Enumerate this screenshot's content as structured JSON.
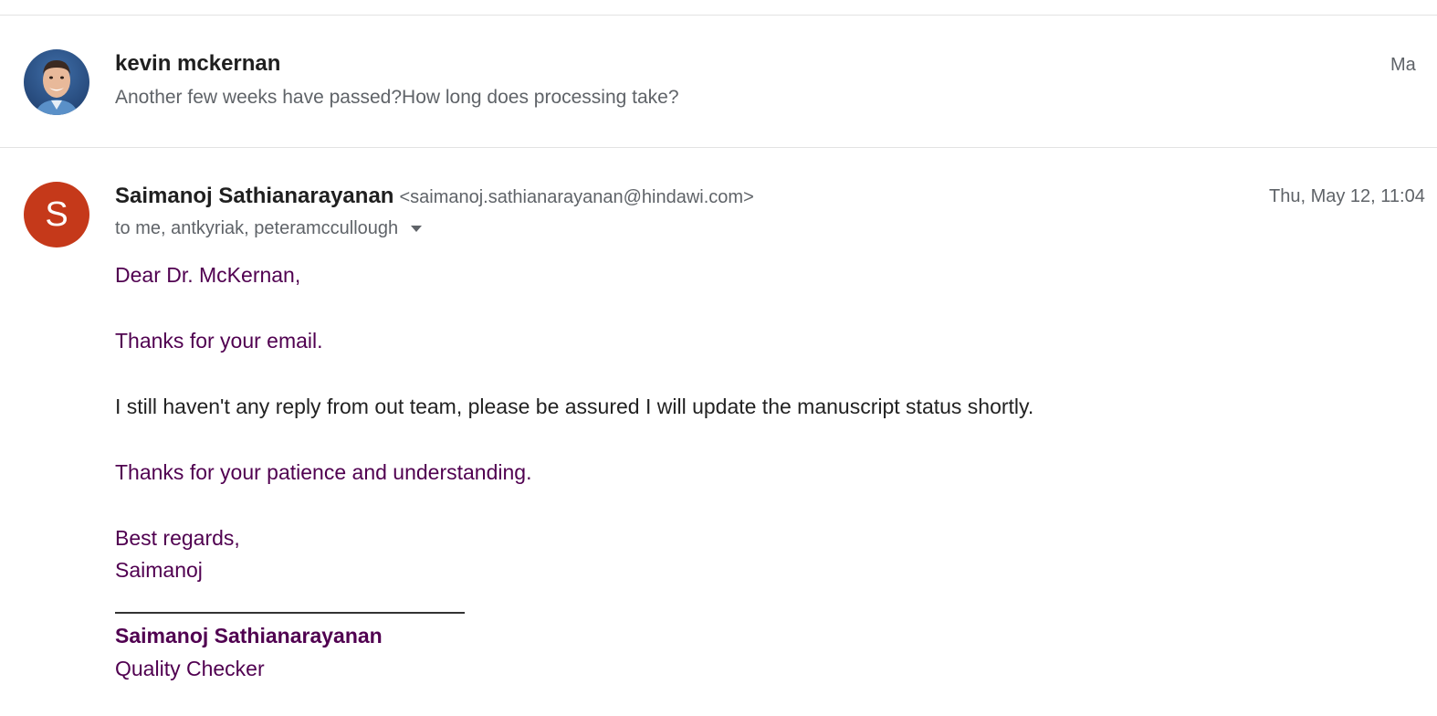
{
  "colors": {
    "quoted_text": "#500050",
    "body_text": "#222222",
    "meta_text": "#5f6368",
    "avatar_letter_bg": "#c5391a",
    "divider": "#e3e3e3"
  },
  "collapsed_message": {
    "sender": "kevin mckernan",
    "snippet": "Another few weeks have passed?How long does processing take?",
    "date": "Ma",
    "avatar_icon": "profile-photo"
  },
  "open_message": {
    "avatar_letter": "S",
    "sender": "Saimanoj Sathianarayanan",
    "email": "<saimanoj.sathianarayanan@hindawi.com>",
    "date": "Thu, May 12, 11:04",
    "recipients": "to me, antkyriak, peteramccullough",
    "dropdown_icon": "caret-down",
    "body": {
      "greeting": "Dear Dr. McKernan,",
      "thanks": "Thanks for your email.",
      "update": "I still haven't any reply from out team, please be assured I will update the manuscript status shortly.",
      "patience": "Thanks for your patience and understanding.",
      "closing": "Best regards,",
      "signoff": "Saimanoj"
    },
    "signature": {
      "name": "Saimanoj Sathianarayanan",
      "title": "Quality Checker"
    }
  }
}
